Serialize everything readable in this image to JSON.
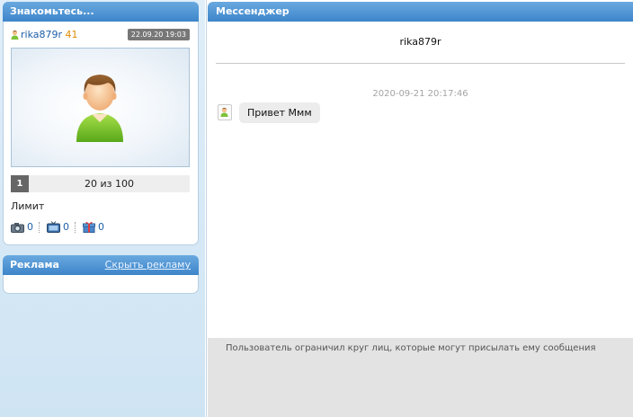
{
  "meet_panel": {
    "title": "Знакомьтесь...",
    "username": "rika879r",
    "score": "41",
    "date": "22.09.20 19:03",
    "counter_num": "1",
    "counter_text": "20 из 100",
    "limit_label": "Лимит",
    "stats": {
      "photos": "0",
      "videos": "0",
      "gifts": "0"
    }
  },
  "ad_panel": {
    "title": "Реклама",
    "hide_link": "Скрыть рекламу"
  },
  "messenger": {
    "title": "Мессенджер",
    "recipient": "rika879r",
    "timestamp": "2020-09-21 20:17:46",
    "message": "Привет Ммм",
    "notice": "Пользователь ограничил круг лиц, которые могут присылать ему сообщения"
  },
  "colors": {
    "header_blue": "#3d85c9",
    "link_blue": "#1e5fa8",
    "score_orange": "#e08a00"
  }
}
